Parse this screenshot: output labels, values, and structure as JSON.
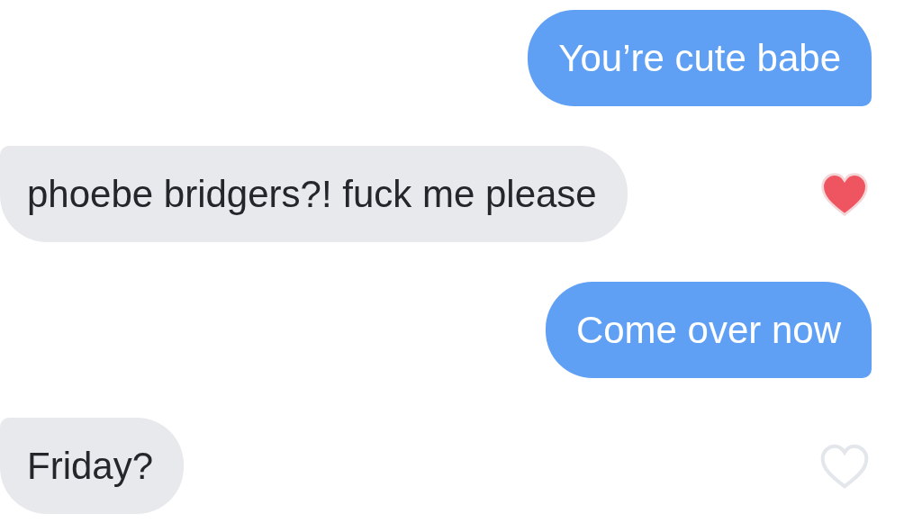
{
  "messages": [
    {
      "kind": "sent",
      "text": "You’re cute babe"
    },
    {
      "kind": "received",
      "text": "phoebe bridgers?! fuck me please",
      "liked": true
    },
    {
      "kind": "sent",
      "text": "Come over now"
    },
    {
      "kind": "received",
      "text": "Friday?",
      "liked": false
    }
  ]
}
